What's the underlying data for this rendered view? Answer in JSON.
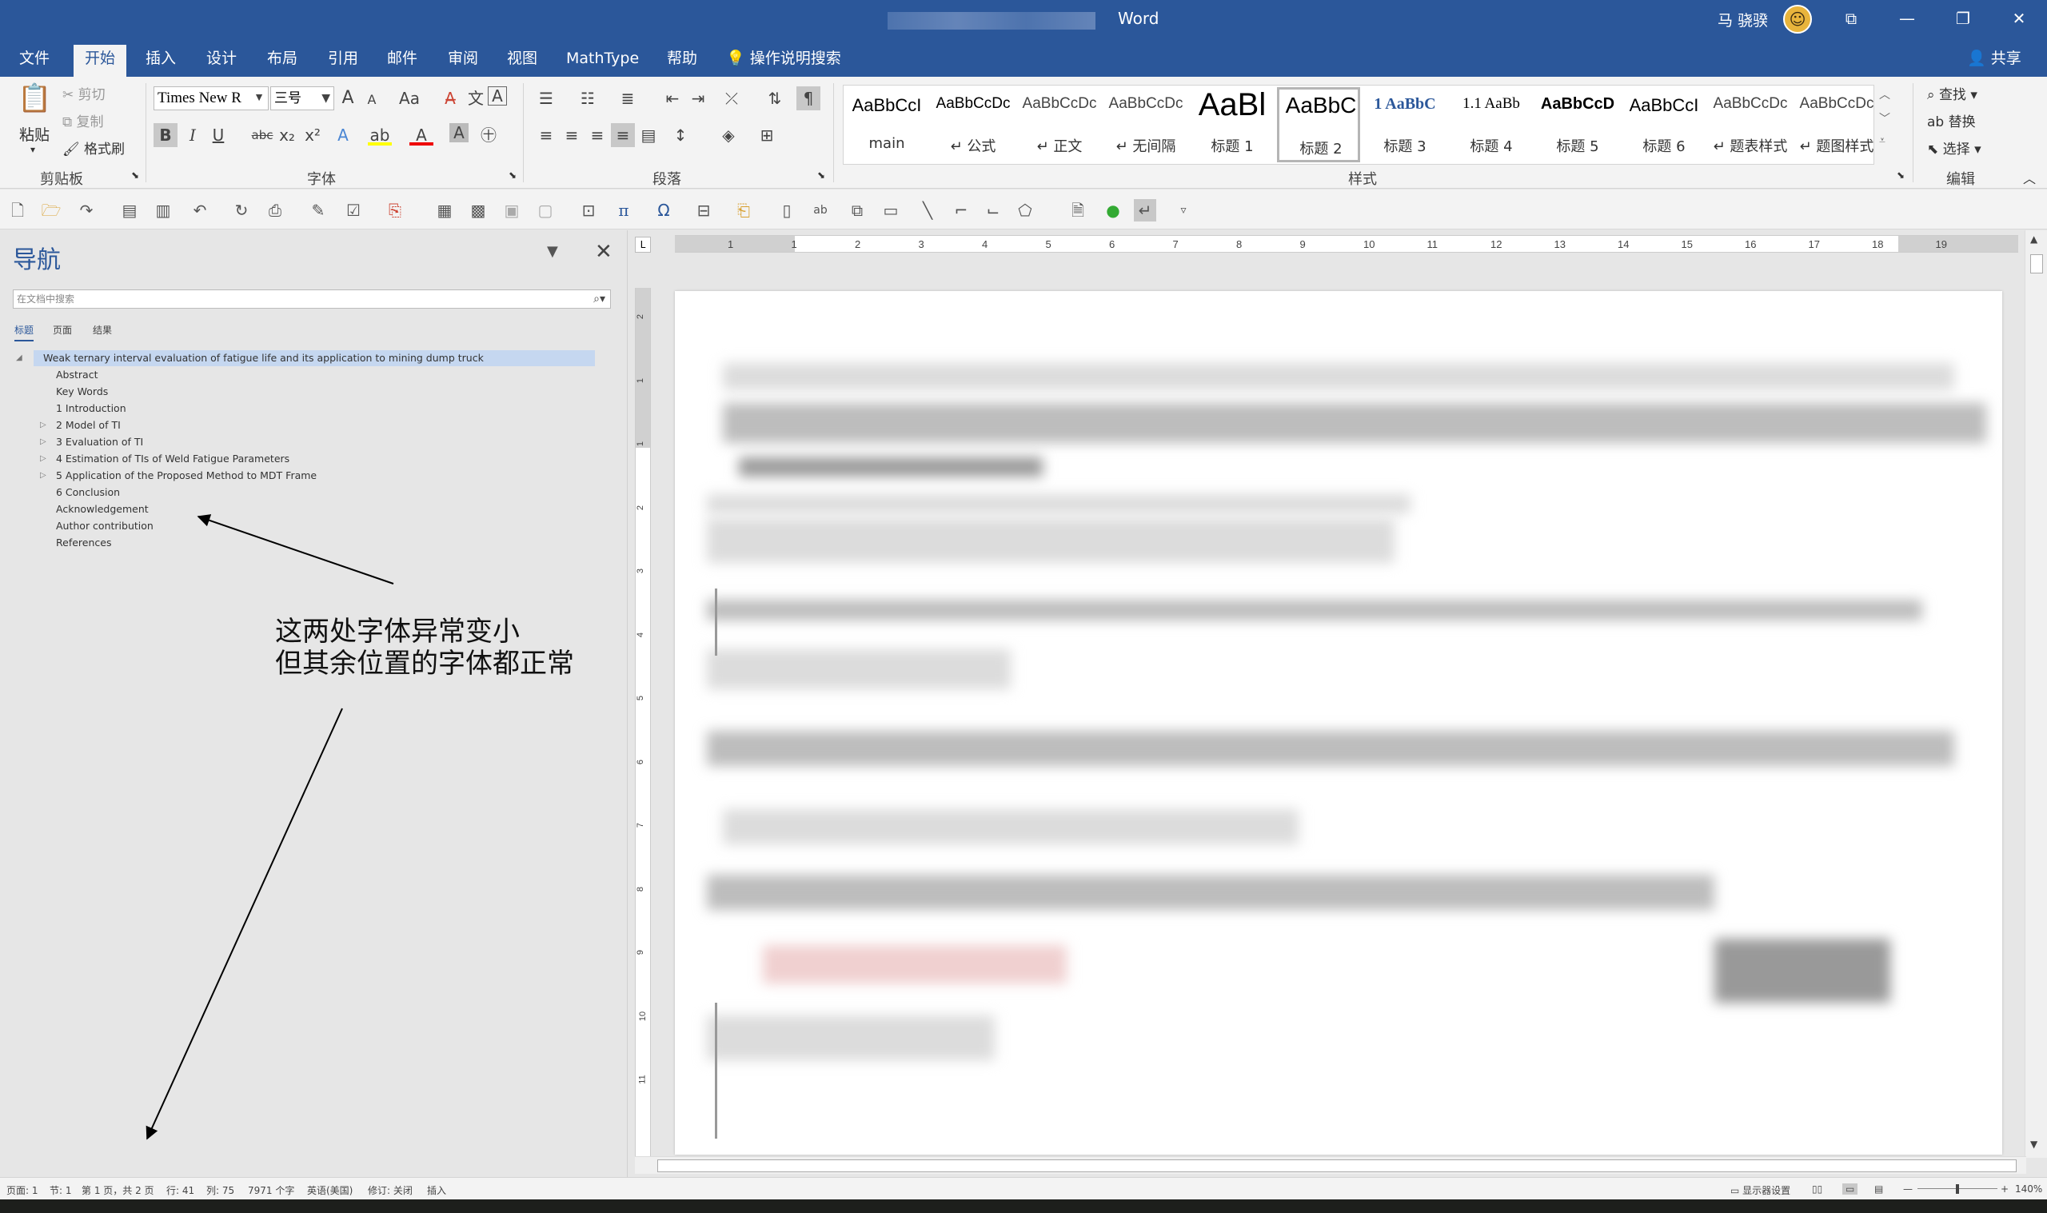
{
  "window": {
    "app_title": "Word",
    "user_name": "马 骁骙",
    "avatar_glyph": "☺",
    "buttons": [
      "⧉",
      "—",
      "❐",
      "✕"
    ]
  },
  "tabs": {
    "items": [
      "文件",
      "开始",
      "插入",
      "设计",
      "布局",
      "引用",
      "邮件",
      "审阅",
      "视图",
      "MathType",
      "帮助"
    ],
    "active": "开始",
    "search_label": "操作说明搜索",
    "share_label": "共享"
  },
  "clipboard": {
    "paste_label": "粘贴",
    "cut_label": "剪切",
    "copy_label": "复制",
    "format_painter_label": "格式刷",
    "group_label": "剪贴板"
  },
  "font": {
    "font_name": "Times New R",
    "font_size": "三号",
    "group_label": "字体",
    "bold": "B",
    "italic": "I",
    "underline": "U",
    "strike": "abc",
    "subscript": "x₂",
    "superscript": "x²",
    "grow": "A",
    "shrink": "A",
    "case": "Aa",
    "font_color": "A",
    "highlight": "ab"
  },
  "paragraph": {
    "group_label": "段落"
  },
  "styles": {
    "group_label": "样式",
    "items": [
      {
        "sample": "AaBbCcI",
        "name": "main"
      },
      {
        "sample": "AaBbCcDc",
        "name": "↵ 公式"
      },
      {
        "sample": "AaBbCcDc",
        "name": "↵ 正文"
      },
      {
        "sample": "AaBbCcDc",
        "name": "↵ 无间隔"
      },
      {
        "sample": "AaBl",
        "name": "标题 1"
      },
      {
        "sample": "AaBbC",
        "name": "标题 2"
      },
      {
        "sample": "1 AaBbC",
        "name": "标题 3"
      },
      {
        "sample": "1.1 AaBb",
        "name": "标题 4"
      },
      {
        "sample": "AaBbCcD",
        "name": "标题 5"
      },
      {
        "sample": "AaBbCcI",
        "name": "标题 6"
      },
      {
        "sample": "AaBbCcDc",
        "name": "↵ 题表样式"
      },
      {
        "sample": "AaBbCcDc",
        "name": "↵ 题图样式"
      }
    ],
    "selected_index": 5
  },
  "editing": {
    "find_label": "查找",
    "replace_label": "替换",
    "select_label": "选择",
    "group_label": "编辑"
  },
  "nav": {
    "title": "导航",
    "search_placeholder": "在文档中搜索",
    "tabs": [
      "标题",
      "页面",
      "结果"
    ],
    "active_tab": "标题",
    "headings": [
      {
        "text": "Weak ternary interval evaluation of fatigue life and its application to mining dump truck",
        "level": 1,
        "expander": "◢",
        "selected": true
      },
      {
        "text": "Abstract",
        "level": 2,
        "expander": ""
      },
      {
        "text": "Key Words",
        "level": 2,
        "expander": ""
      },
      {
        "text": "1 Introduction",
        "level": 2,
        "expander": ""
      },
      {
        "text": "2 Model of TI",
        "level": 2,
        "expander": "▷"
      },
      {
        "text": "3 Evaluation of TI",
        "level": 2,
        "expander": "▷"
      },
      {
        "text": "4  Estimation of TIs of Weld Fatigue Parameters",
        "level": 2,
        "expander": "▷"
      },
      {
        "text": "5 Application of the Proposed Method to MDT Frame",
        "level": 2,
        "expander": "▷"
      },
      {
        "text": "6 Conclusion",
        "level": 2,
        "expander": ""
      },
      {
        "text": "Acknowledgement",
        "level": 2,
        "expander": ""
      },
      {
        "text": "Author contribution",
        "level": 2,
        "expander": ""
      },
      {
        "text": "References",
        "level": 2,
        "expander": ""
      }
    ]
  },
  "annotation": {
    "line1": "这两处字体异常变小",
    "line2": "但其余位置的字体都正常"
  },
  "ruler": {
    "h_ticks": [
      "1",
      "1",
      "2",
      "3",
      "4",
      "5",
      "6",
      "7",
      "8",
      "9",
      "10",
      "11",
      "12",
      "13",
      "14",
      "15",
      "16",
      "17",
      "18",
      "19"
    ],
    "v_ticks": [
      "2",
      "1",
      "1",
      "2",
      "3",
      "4",
      "5",
      "6",
      "7",
      "8",
      "9",
      "10",
      "11"
    ]
  },
  "status": {
    "page": "页面: 1",
    "section": "节: 1",
    "page_of": "第 1 页，共 2 页",
    "row": "行: 41",
    "col": "列: 75",
    "words": "7971 个字",
    "language": "英语(美国)",
    "track": "修订: 关闭",
    "insert": "插入",
    "display_settings": "显示器设置",
    "zoom": "140%"
  }
}
